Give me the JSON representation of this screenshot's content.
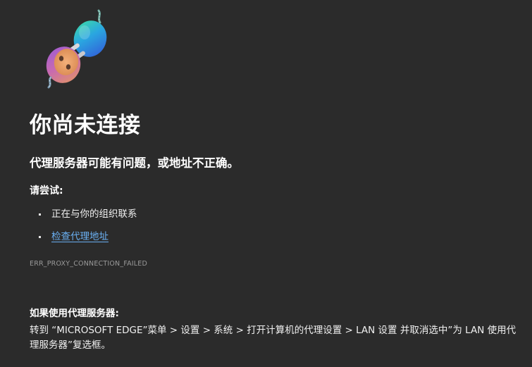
{
  "error_page": {
    "illustration_icon": "unplugged-connector-icon",
    "title": "你尚未连接",
    "subtitle": "代理服务器可能有问题，或地址不正确。",
    "try_heading": "请尝试:",
    "suggestions": [
      {
        "text": "正在与你的组织联系",
        "is_link": false
      },
      {
        "text": "检查代理地址",
        "is_link": true
      }
    ],
    "error_code": "ERR_PROXY_CONNECTION_FAILED",
    "proxy_heading": "如果使用代理服务器:",
    "proxy_instructions": "转到 “MICROSOFT EDGE”菜单 > 设置 > 系统 > 打开计算机的代理设置 > LAN 设置 并取消选中”为 LAN 使用代理服务器”复选框。"
  },
  "colors": {
    "background": "#2b2b2b",
    "text": "#ffffff",
    "link": "#6ab0f3",
    "muted": "#9a9a9a"
  }
}
